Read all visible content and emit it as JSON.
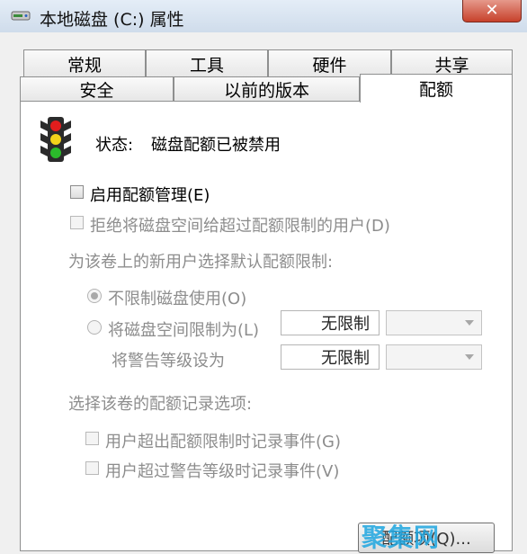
{
  "window": {
    "title": "本地磁盘 (C:) 属性",
    "close_glyph": "✕"
  },
  "tabs": {
    "row1": [
      {
        "label": "常规"
      },
      {
        "label": "工具"
      },
      {
        "label": "硬件"
      },
      {
        "label": "共享"
      }
    ],
    "row2": [
      {
        "label": "安全"
      },
      {
        "label": "以前的版本"
      },
      {
        "label": "配额",
        "active": true
      }
    ]
  },
  "status": {
    "label": "状态:",
    "value": "磁盘配额已被禁用",
    "icon": "traffic-light-icon"
  },
  "options": {
    "enable_quota": "启用配额管理(E)",
    "deny_space": "拒绝将磁盘空间给超过配额限制的用户(D)",
    "default_limit_heading": "为该卷上的新用户选择默认配额限制:",
    "no_limit": "不限制磁盘使用(O)",
    "limit_space": "将磁盘空间限制为(L)",
    "limit_value": "无限制",
    "warning_level": "将警告等级设为",
    "warning_value": "无限制",
    "logging_heading": "选择该卷的配额记录选项:",
    "log_limit": "用户超出配额限制时记录事件(G)",
    "log_warning": "用户超过警告等级时记录事件(V)"
  },
  "footer": {
    "button_label": "配额项(Q)...",
    "watermark": "聚集网"
  },
  "colors": {
    "red_light": "#e21d1d",
    "yellow_light": "#f2d21a",
    "green_light": "#2bbb2b",
    "watermark": "#1ea6e0"
  }
}
